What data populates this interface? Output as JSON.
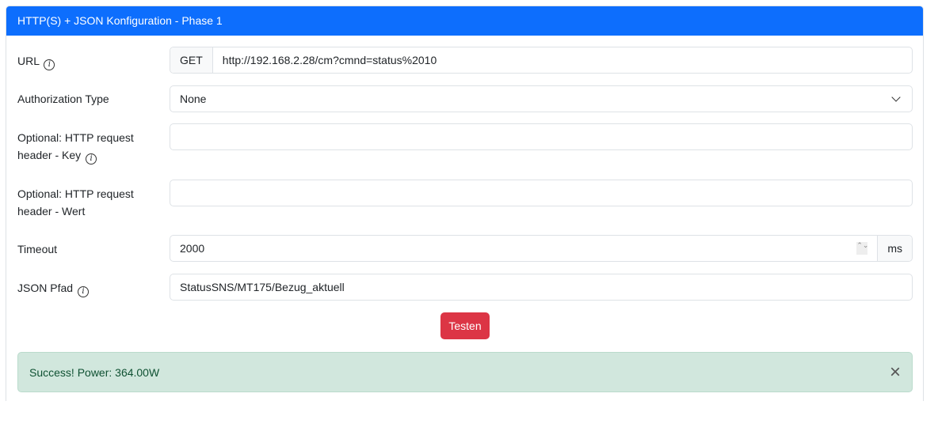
{
  "header": {
    "title": "HTTP(S) + JSON Konfiguration - Phase 1"
  },
  "url": {
    "label": "URL",
    "method": "GET",
    "value": "http://192.168.2.28/cm?cmnd=status%2010"
  },
  "auth": {
    "label": "Authorization Type",
    "value": "None"
  },
  "header_key": {
    "label_line1": "Optional: HTTP request",
    "label_line2": "header - Key",
    "value": ""
  },
  "header_value": {
    "label_line1": "Optional: HTTP request",
    "label_line2": "header - Wert",
    "value": ""
  },
  "timeout": {
    "label": "Timeout",
    "value": "2000",
    "unit": "ms"
  },
  "json_path": {
    "label": "JSON Pfad",
    "value": "StatusSNS/MT175/Bezug_aktuell"
  },
  "test_button": {
    "label": "Testen"
  },
  "alert": {
    "message": "Success! Power: 364.00W"
  },
  "icons": {
    "info": "i",
    "close": "×",
    "spinner": "⌃⌄"
  }
}
